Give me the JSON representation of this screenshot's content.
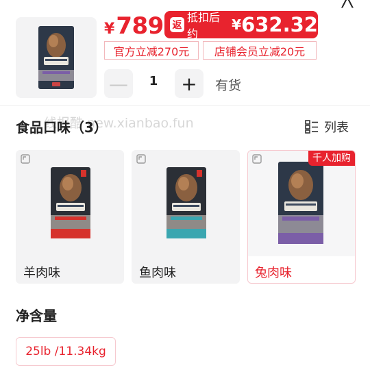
{
  "header": {
    "close_glyph": "╳"
  },
  "product": {
    "price_currency": "¥",
    "price": "789",
    "discount": {
      "label": "抵扣后约",
      "currency": "¥",
      "price": "632.32",
      "tag_glyph": "返"
    },
    "coupons": [
      "官方立减270元",
      "店铺会员立减20元"
    ],
    "quantity": "1",
    "minus_glyph": "—",
    "plus_glyph": "+",
    "stock_status": "有货"
  },
  "watermark": "线报酷 new.xianbao.fun",
  "flavor_section": {
    "title": "食品口味（3）",
    "view_toggle": "列表",
    "options": [
      {
        "label": "羊肉味",
        "selected": false,
        "accent": "#d6322c"
      },
      {
        "label": "鱼肉味",
        "selected": false,
        "accent": "#3aa6b0"
      },
      {
        "label": "兔肉味",
        "selected": true,
        "accent": "#7b5ea7",
        "badge": "千人加购"
      }
    ]
  },
  "net_section": {
    "title": "净含量",
    "options": [
      {
        "label": "25lb /11.34kg",
        "selected": true
      }
    ]
  },
  "colors": {
    "accent": "#e8232e",
    "card_bg": "#f3f3f4",
    "selected_border": "#f6c9cf"
  }
}
